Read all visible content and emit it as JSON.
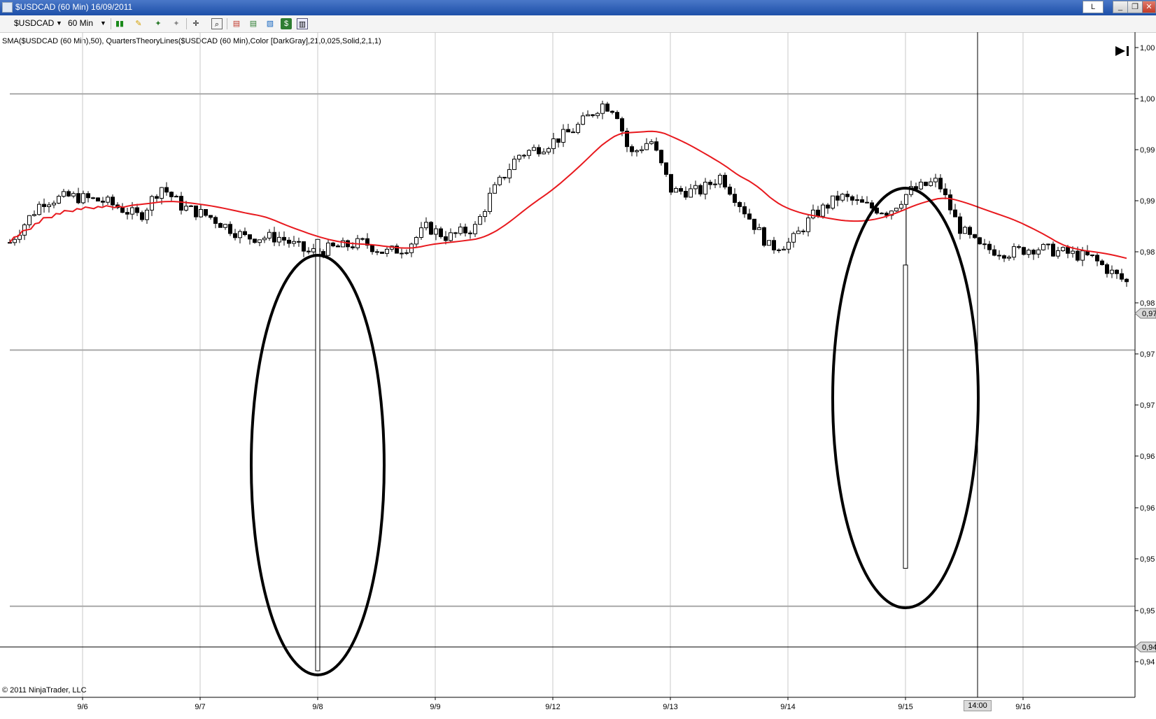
{
  "window": {
    "title": "$USDCAD (60 Min)  16/09/2011",
    "l_button": "L",
    "minimize": "_",
    "restore": "❐",
    "close": "✕"
  },
  "toolbar": {
    "instrument": "$USDCAD",
    "interval": "60 Min"
  },
  "indicator_label": "SMA($USDCAD (60 Min),50), QuartersTheoryLines($USDCAD (60 Min),Color [DarkGray],21,0,025,Solid,2,1,1)",
  "copyright": "© 2011 NinjaTrader, LLC",
  "crosshair": {
    "time_label": "14:00",
    "price_label": "0,94"
  },
  "colors": {
    "sma": "#e8191e",
    "quarter_lines": "#a9a9a9",
    "vertical_grid": "#c8c8c8",
    "candle_up": "#ffffff",
    "candle_down": "#000000"
  },
  "chart_data": {
    "type": "candlestick",
    "x_ticks": [
      "9/6",
      "9/7",
      "9/8",
      "9/9",
      "9/12",
      "9/13",
      "9/14",
      "9/15",
      "9/16"
    ],
    "y_ticks": [
      "1,00",
      "1,00",
      "0,99",
      "0,99",
      "0,98",
      "0,98",
      "0,97",
      "0,97",
      "0,96",
      "0,96",
      "0,95",
      "0,95",
      "0,94"
    ],
    "quarter_lines": [
      1.0,
      0.975,
      0.95
    ],
    "last_price_label": "0,97",
    "series": [
      {
        "name": "SMA($USDCAD (60 Min),50)",
        "style": "line"
      }
    ],
    "annotations": [
      "ellipse around 9/8 spike low",
      "ellipse around 9/15 spike low"
    ]
  }
}
